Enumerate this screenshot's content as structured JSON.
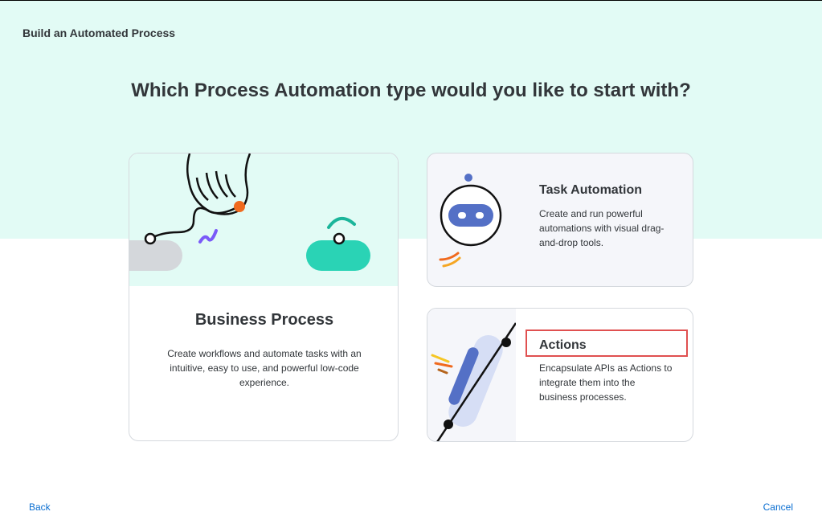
{
  "dialog": {
    "title": "Build an Automated Process",
    "question": "Which Process Automation type would you like to start with?"
  },
  "options": {
    "business_process": {
      "title": "Business Process",
      "description": "Create workflows and automate tasks with an intuitive, easy to use, and powerful low-code experience."
    },
    "task_automation": {
      "title": "Task Automation",
      "description": "Create and run powerful automations with visual drag-and-drop tools."
    },
    "actions": {
      "title": "Actions",
      "description": "Encapsulate APIs as Actions to integrate them into the business processes."
    }
  },
  "footer": {
    "back_label": "Back",
    "cancel_label": "Cancel"
  },
  "colors": {
    "hero_background": "#e2fbf5",
    "link": "#0a6ed1",
    "highlight": "#e05050",
    "accent_teal": "#2ad3b5",
    "accent_blue": "#5470c6",
    "accent_orange": "#f06a1e",
    "accent_purple": "#7a5af8"
  },
  "icons": {
    "business_process": "hand-holding-node-illustration",
    "task_automation": "robot-illustration",
    "actions": "api-connector-illustration"
  }
}
